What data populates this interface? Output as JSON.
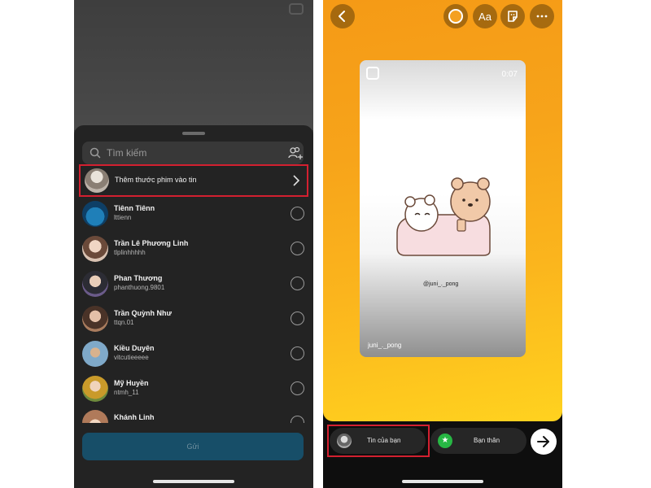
{
  "left_screen": {
    "search": {
      "placeholder": "Tìm kiếm"
    },
    "add_reel_row": {
      "label": "Thêm thước phim vào tin"
    },
    "contacts": [
      {
        "name": "Tiênn Tiênn",
        "handle": "lttienn"
      },
      {
        "name": "Trần Lê Phương Linh",
        "handle": "tlplinhhhhh"
      },
      {
        "name": "Phan Thương",
        "handle": "phanthuong.9801"
      },
      {
        "name": "Trần Quỳnh Như",
        "handle": "ttqn.01"
      },
      {
        "name": "Kiều Duyên",
        "handle": "vitcutieeeee"
      },
      {
        "name": "Mỹ Huyền",
        "handle": "ntmh_11"
      },
      {
        "name": "Khánh Linh",
        "handle": ""
      }
    ],
    "send_button": {
      "label": "Gửi"
    }
  },
  "right_screen": {
    "toolbar": {
      "text_tool_label": "Aa"
    },
    "reel": {
      "duration": "0:07",
      "caption": "@juni_._pong",
      "author": "juni_._pong"
    },
    "share_options": {
      "your_story_label": "Tin của bạn",
      "close_friends_label": "Bạn thân"
    }
  },
  "colors": {
    "highlight_outline": "#d32030",
    "send_button_bg": "#174e68",
    "close_friends_green": "#27b744",
    "story_gradient_top": "#f59a16",
    "story_gradient_bottom": "#ffd21f"
  }
}
